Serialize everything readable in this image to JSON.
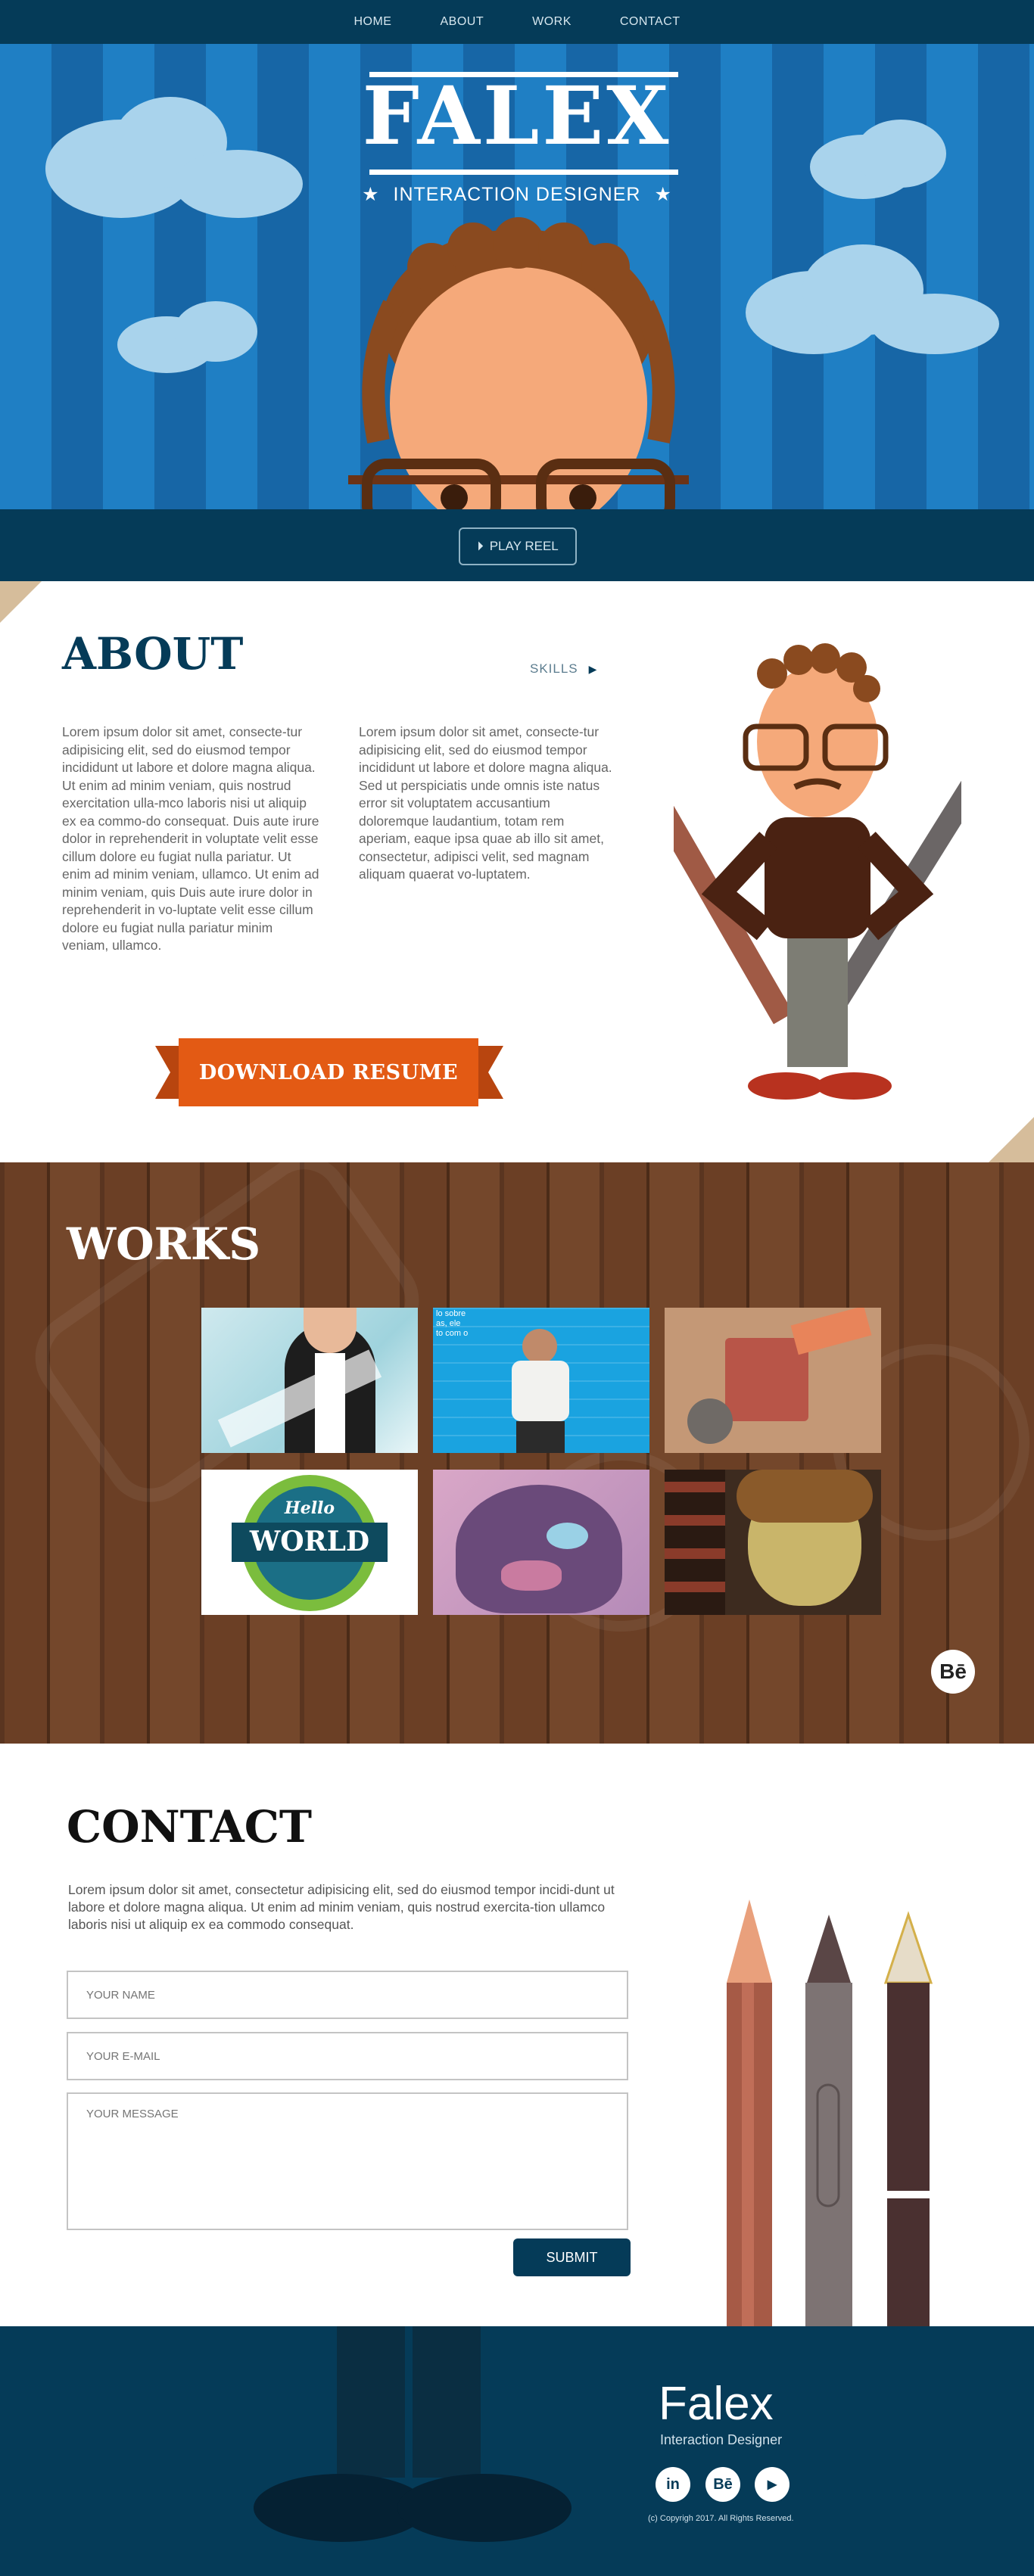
{
  "nav": {
    "items": [
      "HOME",
      "ABOUT",
      "WORK",
      "CONTACT"
    ]
  },
  "hero": {
    "title": "FALEX",
    "subtitle": "INTERACTION DESIGNER",
    "play_label": "PLAY REEL"
  },
  "about": {
    "title": "ABOUT",
    "skills_label": "SKILLS",
    "paragraph1": "Lorem ipsum dolor sit amet, consecte-tur adipisicing elit, sed do eiusmod tempor incididunt ut labore et dolore magna aliqua. Ut enim ad minim veniam, quis nostrud exercitation ulla-mco laboris nisi ut aliquip ex ea commo-do consequat. Duis aute irure dolor in reprehenderit in voluptate velit esse cillum dolore eu fugiat nulla pariatur. Ut enim ad minim veniam, ullamco. Ut enim ad minim veniam, quis  Duis aute irure dolor in reprehenderit in vo-luptate velit esse cillum dolore eu fugiat nulla pariatur minim veniam, ullamco.",
    "paragraph2": "Lorem ipsum dolor sit amet, consecte-tur adipisicing elit, sed do eiusmod tempor incididunt ut labore et dolore magna aliqua. Sed ut perspiciatis unde omnis iste natus error sit voluptatem accusantium doloremque laudantium, totam rem aperiam, eaque ipsa quae ab illo sit amet, consectetur, adipisci velit, sed magnam aliquam quaerat vo-luptatem.",
    "resume_label": "DOWNLOAD RESUME"
  },
  "works": {
    "title": "WORKS",
    "thumb_texts": {
      "hello": "Hello",
      "world": "WORLD",
      "blue_text": "lo sobre\nas, ele\nto com o"
    },
    "behance_label": "Bē"
  },
  "contact": {
    "title": "CONTACT",
    "paragraph": "Lorem ipsum dolor sit amet, consectetur adipisicing elit, sed do eiusmod tempor incidi-dunt ut labore et dolore magna aliqua. Ut enim ad minim veniam, quis nostrud exercita-tion ullamco laboris nisi ut aliquip ex ea commodo consequat.",
    "name_placeholder": "YOUR NAME",
    "email_placeholder": "YOUR E-MAIL",
    "message_placeholder": "YOUR MESSAGE",
    "submit_label": "SUBMIT"
  },
  "footer": {
    "brand": "Falex",
    "subtitle": "Interaction Designer",
    "social": [
      "in",
      "Bē",
      "▶"
    ],
    "copyright": "(c) Copyrigh 2017. All Rights Reserved."
  }
}
